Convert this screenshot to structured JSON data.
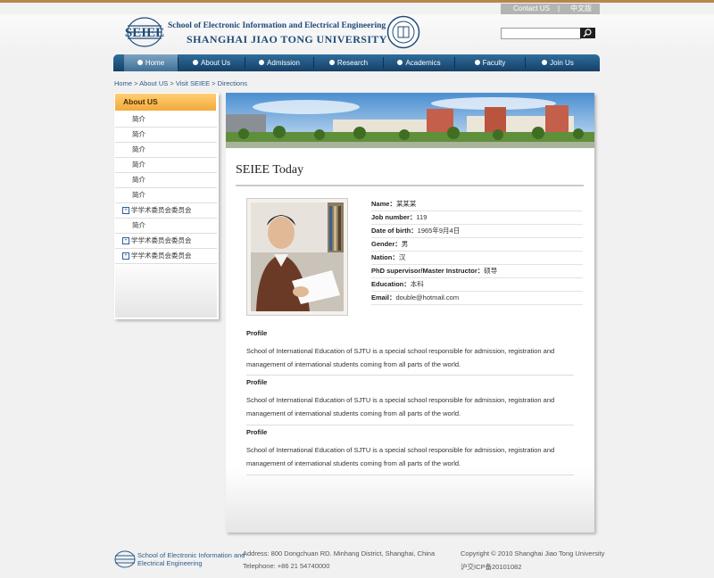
{
  "topbar": {
    "contact": "Contact US",
    "separator": "|",
    "language": "中文版"
  },
  "logo": {
    "line1": "School of Electronic Information and Electrical Engineering",
    "line2": "SHANGHAI JIAO TONG UNIVERSITY"
  },
  "search": {
    "placeholder": ""
  },
  "nav": {
    "items": [
      {
        "label": "Home"
      },
      {
        "label": "About Us"
      },
      {
        "label": "Admission"
      },
      {
        "label": "Research"
      },
      {
        "label": "Academics"
      },
      {
        "label": "Faculty"
      },
      {
        "label": "Join Us"
      }
    ]
  },
  "breadcrumb": {
    "items": [
      "Home",
      "About US",
      "Visit SEIEE",
      "Directions"
    ],
    "separator": ">"
  },
  "sidebar": {
    "title": "About US",
    "items": [
      {
        "label": "简介",
        "expandable": false
      },
      {
        "label": "简介",
        "expandable": false
      },
      {
        "label": "简介",
        "expandable": false
      },
      {
        "label": "简介",
        "expandable": false
      },
      {
        "label": "简介",
        "expandable": false
      },
      {
        "label": "简介",
        "expandable": false
      },
      {
        "label": "学学术委员会委员会",
        "expandable": true
      },
      {
        "label": "简介",
        "expandable": false
      },
      {
        "label": "学学术委员会委员会",
        "expandable": true
      },
      {
        "label": "学学术委员会委员会",
        "expandable": true
      }
    ]
  },
  "main": {
    "title": "SEIEE Today",
    "info": [
      {
        "label": "Name：",
        "value": "某某某"
      },
      {
        "label": "Job number：",
        "value": "119"
      },
      {
        "label": "Date of birth：",
        "value": "1965年9月4日"
      },
      {
        "label": "Gender：",
        "value": "男"
      },
      {
        "label": "Nation：",
        "value": "汉"
      },
      {
        "label": "PhD supervisor/Master Instructor：",
        "value": "硕导"
      },
      {
        "label": "Education：",
        "value": "本科"
      },
      {
        "label": "Email：",
        "value": "double@hotmail.com"
      }
    ],
    "profiles": [
      {
        "title": "Profile",
        "line1": "School of International Education of SJTU is a special school responsible for admission, registration and",
        "line2": "management of international students coming from all parts of the world."
      },
      {
        "title": "Profile",
        "line1": "School of International Education of SJTU is a special school responsible for admission, registration and",
        "line2": "management of international students coming from all parts of the world."
      },
      {
        "title": "Profile",
        "line1": "School of International Education of SJTU is a special school responsible for admission, registration and",
        "line2": "management of international students coming from all parts of the world."
      }
    ]
  },
  "footer": {
    "logo_line1": "School of Electronic Information and",
    "logo_line2": "Electrical Engineering",
    "address": "Address: 800 Dongchuan RD. Minhang District, Shanghai, China",
    "telephone": "Telephone: +86 21 54740000",
    "copyright": "Copyright © 2010 Shanghai Jiao Tong University",
    "icp": "沪交ICP备20101082"
  },
  "colors": {
    "nav_dark": "#153f67",
    "nav_light": "#2f6e9c",
    "sidebar_title": "#f3a93a",
    "link": "#2b5b88",
    "top_rule": "#b7864c"
  }
}
